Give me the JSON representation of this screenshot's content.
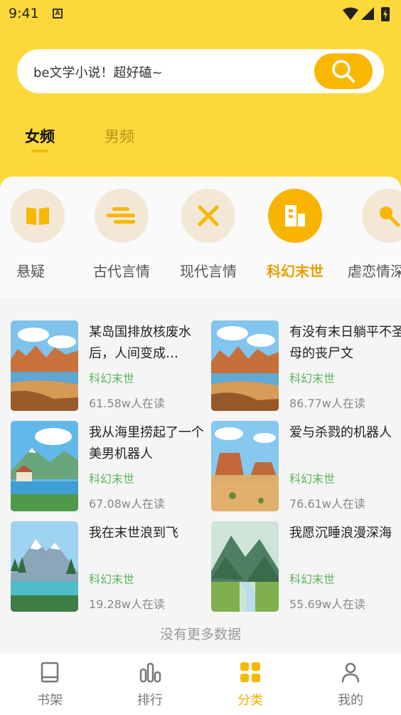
{
  "status_bar": {
    "time": "9:41",
    "badge": "A"
  },
  "search": {
    "placeholder": "be文学小说！超好磕~"
  },
  "tabs": [
    {
      "label": "女频",
      "active": true
    },
    {
      "label": "男频",
      "active": false
    }
  ],
  "categories": [
    {
      "label": "悬疑",
      "icon": "book-icon",
      "active": false
    },
    {
      "label": "古代言情",
      "icon": "cloud-icon",
      "active": false
    },
    {
      "label": "现代言情",
      "icon": "crossed-swords-icon",
      "active": false
    },
    {
      "label": "科幻末世",
      "icon": "building-icon",
      "active": true
    },
    {
      "label": "虐恋情深",
      "icon": "magnifier-icon",
      "active": false
    }
  ],
  "books": [
    {
      "title": "某岛国排放核废水后，人间变成…",
      "category": "科幻末世",
      "readers": "61.58w人在读",
      "cover": "desert-mesa-lake"
    },
    {
      "title": "有没有末日躺平不圣母的丧尸文",
      "category": "科幻末世",
      "readers": "86.77w人在读",
      "cover": "desert-mesa-lake"
    },
    {
      "title": "我从海里捞起了一个美男机器人",
      "category": "科幻末世",
      "readers": "67.08w人在读",
      "cover": "lakeside-village"
    },
    {
      "title": "爱与杀戮的机器人",
      "category": "科幻末世",
      "readers": "76.61w人在读",
      "cover": "desert-canyon"
    },
    {
      "title": "我在末世浪到飞",
      "category": "科幻末世",
      "readers": "19.28w人在读",
      "cover": "snowy-peak-lake"
    },
    {
      "title": "我愿沉睡浪漫深海",
      "category": "科幻末世",
      "readers": "55.69w人在读",
      "cover": "green-valley-river"
    }
  ],
  "no_more_text": "没有更多数据",
  "tabbar": [
    {
      "label": "书架",
      "icon": "book-icon",
      "active": false
    },
    {
      "label": "排行",
      "icon": "bar-chart-icon",
      "active": false
    },
    {
      "label": "分类",
      "icon": "grid-icon",
      "active": true
    },
    {
      "label": "我的",
      "icon": "person-icon",
      "active": false
    }
  ],
  "colors": {
    "brand_yellow": "#fdd83a",
    "accent": "#f6b800",
    "category_green": "#5bb35a"
  }
}
